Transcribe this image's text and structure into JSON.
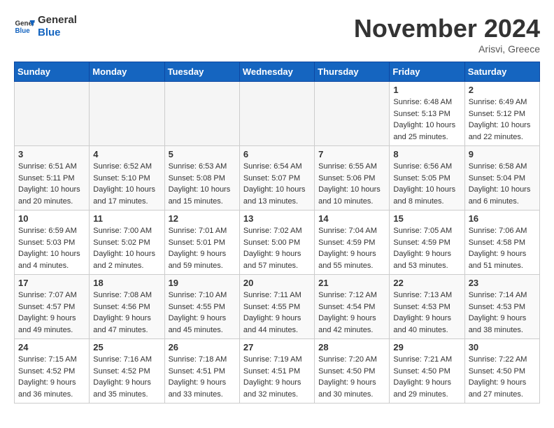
{
  "header": {
    "logo_line1": "General",
    "logo_line2": "Blue",
    "month_title": "November 2024",
    "location": "Arisvi, Greece"
  },
  "weekdays": [
    "Sunday",
    "Monday",
    "Tuesday",
    "Wednesday",
    "Thursday",
    "Friday",
    "Saturday"
  ],
  "weeks": [
    [
      {
        "day": "",
        "info": ""
      },
      {
        "day": "",
        "info": ""
      },
      {
        "day": "",
        "info": ""
      },
      {
        "day": "",
        "info": ""
      },
      {
        "day": "",
        "info": ""
      },
      {
        "day": "1",
        "info": "Sunrise: 6:48 AM\nSunset: 5:13 PM\nDaylight: 10 hours\nand 25 minutes."
      },
      {
        "day": "2",
        "info": "Sunrise: 6:49 AM\nSunset: 5:12 PM\nDaylight: 10 hours\nand 22 minutes."
      }
    ],
    [
      {
        "day": "3",
        "info": "Sunrise: 6:51 AM\nSunset: 5:11 PM\nDaylight: 10 hours\nand 20 minutes."
      },
      {
        "day": "4",
        "info": "Sunrise: 6:52 AM\nSunset: 5:10 PM\nDaylight: 10 hours\nand 17 minutes."
      },
      {
        "day": "5",
        "info": "Sunrise: 6:53 AM\nSunset: 5:08 PM\nDaylight: 10 hours\nand 15 minutes."
      },
      {
        "day": "6",
        "info": "Sunrise: 6:54 AM\nSunset: 5:07 PM\nDaylight: 10 hours\nand 13 minutes."
      },
      {
        "day": "7",
        "info": "Sunrise: 6:55 AM\nSunset: 5:06 PM\nDaylight: 10 hours\nand 10 minutes."
      },
      {
        "day": "8",
        "info": "Sunrise: 6:56 AM\nSunset: 5:05 PM\nDaylight: 10 hours\nand 8 minutes."
      },
      {
        "day": "9",
        "info": "Sunrise: 6:58 AM\nSunset: 5:04 PM\nDaylight: 10 hours\nand 6 minutes."
      }
    ],
    [
      {
        "day": "10",
        "info": "Sunrise: 6:59 AM\nSunset: 5:03 PM\nDaylight: 10 hours\nand 4 minutes."
      },
      {
        "day": "11",
        "info": "Sunrise: 7:00 AM\nSunset: 5:02 PM\nDaylight: 10 hours\nand 2 minutes."
      },
      {
        "day": "12",
        "info": "Sunrise: 7:01 AM\nSunset: 5:01 PM\nDaylight: 9 hours\nand 59 minutes."
      },
      {
        "day": "13",
        "info": "Sunrise: 7:02 AM\nSunset: 5:00 PM\nDaylight: 9 hours\nand 57 minutes."
      },
      {
        "day": "14",
        "info": "Sunrise: 7:04 AM\nSunset: 4:59 PM\nDaylight: 9 hours\nand 55 minutes."
      },
      {
        "day": "15",
        "info": "Sunrise: 7:05 AM\nSunset: 4:59 PM\nDaylight: 9 hours\nand 53 minutes."
      },
      {
        "day": "16",
        "info": "Sunrise: 7:06 AM\nSunset: 4:58 PM\nDaylight: 9 hours\nand 51 minutes."
      }
    ],
    [
      {
        "day": "17",
        "info": "Sunrise: 7:07 AM\nSunset: 4:57 PM\nDaylight: 9 hours\nand 49 minutes."
      },
      {
        "day": "18",
        "info": "Sunrise: 7:08 AM\nSunset: 4:56 PM\nDaylight: 9 hours\nand 47 minutes."
      },
      {
        "day": "19",
        "info": "Sunrise: 7:10 AM\nSunset: 4:55 PM\nDaylight: 9 hours\nand 45 minutes."
      },
      {
        "day": "20",
        "info": "Sunrise: 7:11 AM\nSunset: 4:55 PM\nDaylight: 9 hours\nand 44 minutes."
      },
      {
        "day": "21",
        "info": "Sunrise: 7:12 AM\nSunset: 4:54 PM\nDaylight: 9 hours\nand 42 minutes."
      },
      {
        "day": "22",
        "info": "Sunrise: 7:13 AM\nSunset: 4:53 PM\nDaylight: 9 hours\nand 40 minutes."
      },
      {
        "day": "23",
        "info": "Sunrise: 7:14 AM\nSunset: 4:53 PM\nDaylight: 9 hours\nand 38 minutes."
      }
    ],
    [
      {
        "day": "24",
        "info": "Sunrise: 7:15 AM\nSunset: 4:52 PM\nDaylight: 9 hours\nand 36 minutes."
      },
      {
        "day": "25",
        "info": "Sunrise: 7:16 AM\nSunset: 4:52 PM\nDaylight: 9 hours\nand 35 minutes."
      },
      {
        "day": "26",
        "info": "Sunrise: 7:18 AM\nSunset: 4:51 PM\nDaylight: 9 hours\nand 33 minutes."
      },
      {
        "day": "27",
        "info": "Sunrise: 7:19 AM\nSunset: 4:51 PM\nDaylight: 9 hours\nand 32 minutes."
      },
      {
        "day": "28",
        "info": "Sunrise: 7:20 AM\nSunset: 4:50 PM\nDaylight: 9 hours\nand 30 minutes."
      },
      {
        "day": "29",
        "info": "Sunrise: 7:21 AM\nSunset: 4:50 PM\nDaylight: 9 hours\nand 29 minutes."
      },
      {
        "day": "30",
        "info": "Sunrise: 7:22 AM\nSunset: 4:50 PM\nDaylight: 9 hours\nand 27 minutes."
      }
    ]
  ]
}
